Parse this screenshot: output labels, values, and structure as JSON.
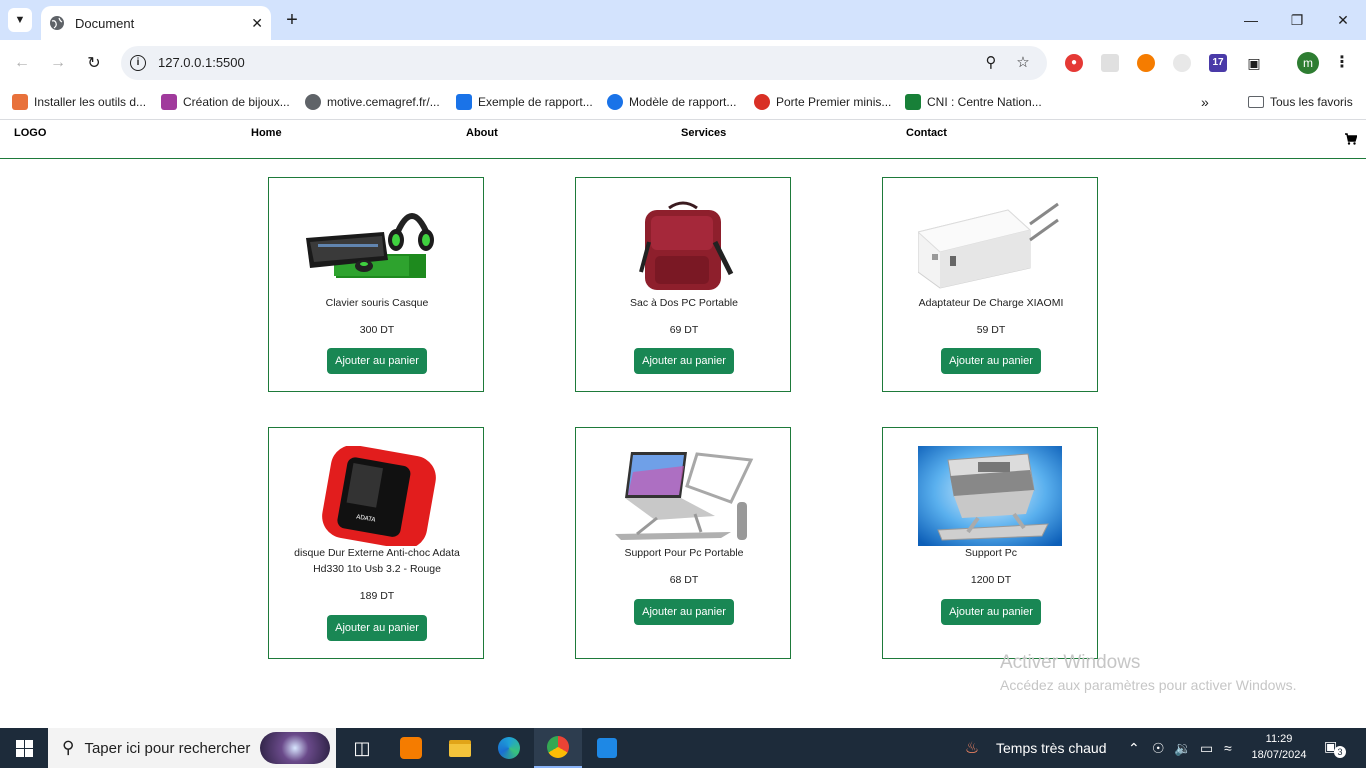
{
  "browser": {
    "tab_title": "Document",
    "url": "127.0.0.1:5500",
    "profile_initial": "m",
    "extension_badge": "17"
  },
  "bookmarks": [
    {
      "label": "Installer les outils d...",
      "color": "#e8713b"
    },
    {
      "label": "Création de bijoux...",
      "color": "#a03a9c"
    },
    {
      "label": "motive.cemagref.fr/...",
      "color": "#5f6368"
    },
    {
      "label": "Exemple de rapport...",
      "color": "#1a73e8"
    },
    {
      "label": "Modèle de rapport...",
      "color": "#1a73e8"
    },
    {
      "label": "Porte Premier minis...",
      "color": "#d93025"
    },
    {
      "label": "CNI : Centre Nation...",
      "color": "#188038"
    }
  ],
  "bookmarks_more": "»",
  "all_bookmarks": "Tous les favoris",
  "site": {
    "logo": "LOGO",
    "nav": [
      "Home",
      "About",
      "Services",
      "Contact"
    ]
  },
  "products": [
    {
      "name": "Clavier souris Casque",
      "price": "300 DT",
      "button": "Ajouter au panier",
      "image": "keyboard-mouse-headset"
    },
    {
      "name": "Sac à Dos PC Portable",
      "price": "69 DT",
      "button": "Ajouter au panier",
      "image": "backpack"
    },
    {
      "name": "Adaptateur De Charge XIAOMI",
      "price": "59 DT",
      "button": "Ajouter au panier",
      "image": "charger"
    },
    {
      "name": "disque Dur Externe Anti-choc Adata Hd330 1to Usb 3.2 - Rouge",
      "price": "189 DT",
      "button": "Ajouter au panier",
      "image": "external-drive"
    },
    {
      "name": "Support Pour Pc Portable",
      "price": "68 DT",
      "button": "Ajouter au panier",
      "image": "laptop-stand"
    },
    {
      "name": "Support Pc",
      "price": "1200 DT",
      "button": "Ajouter au panier",
      "image": "pc-support"
    }
  ],
  "watermark": {
    "line1": "Activer Windows",
    "line2": "Accédez aux paramètres pour activer Windows."
  },
  "taskbar": {
    "search_placeholder": "Taper ici pour rechercher",
    "weather": "Temps très chaud",
    "time": "11:29",
    "date": "18/07/2024",
    "notifications": "3"
  }
}
